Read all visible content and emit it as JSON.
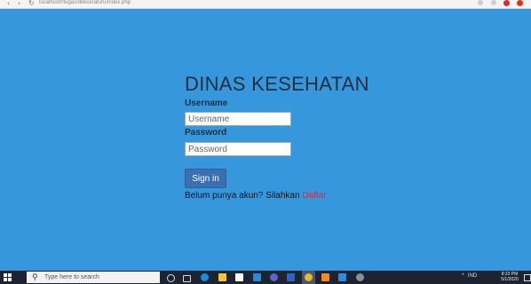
{
  "browser": {
    "address": "localhost/rtugas/diteseraturu/index.php"
  },
  "page": {
    "title": "DINAS KESEHATAN",
    "username_label": "Username",
    "username_placeholder": "Username",
    "password_label": "Password",
    "password_placeholder": "Password",
    "signin_label": "Sign in",
    "signup_prompt": "Belum punya akun? Silahkan ",
    "signup_link": "Daftar"
  },
  "taskbar": {
    "search_placeholder": "Type here to search",
    "tray_lang": "IND",
    "time": "8:23 PM",
    "date": "5/1/2020"
  },
  "colors": {
    "background": "#3797dd",
    "button": "#3a6fb0",
    "link": "#e0263b"
  }
}
